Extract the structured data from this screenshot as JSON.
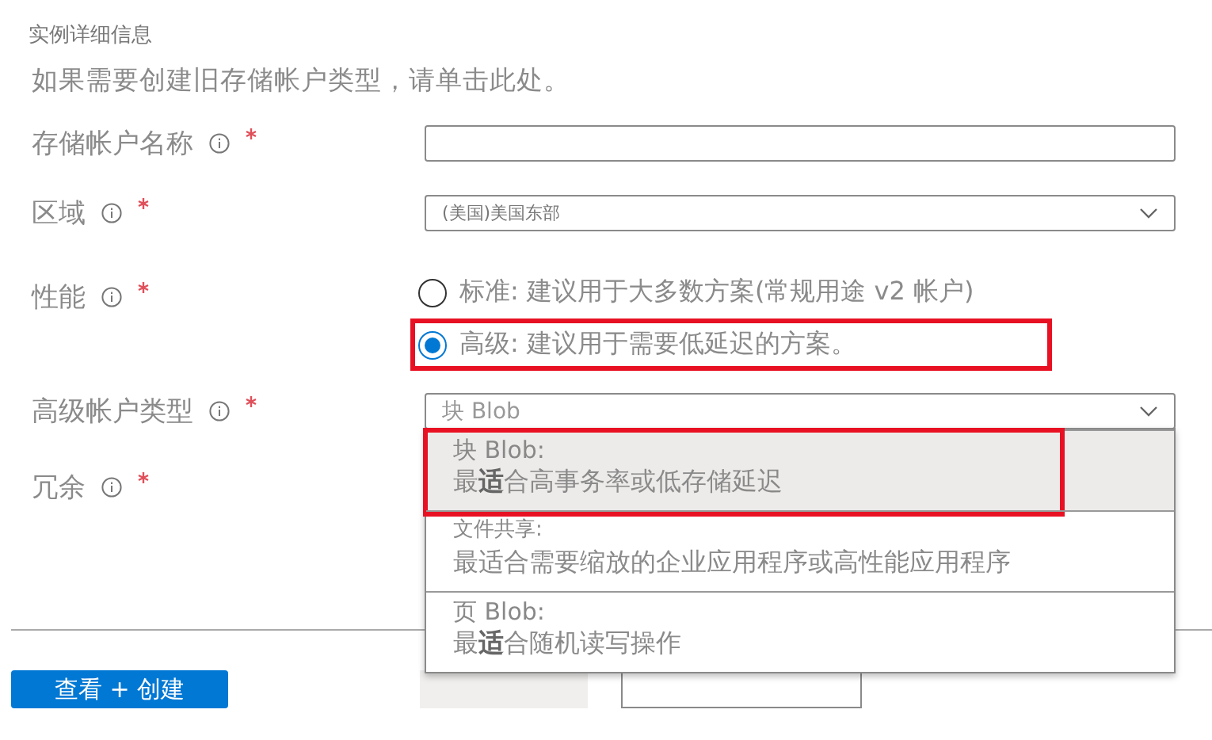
{
  "section_title": "实例详细信息",
  "legacy_link": "如果需要创建旧存储帐户类型，请单击此处。",
  "fields": [
    {
      "kind": "text",
      "label": "存储帐户名称",
      "required": true
    },
    {
      "kind": "select",
      "label": "区域",
      "required": true,
      "value": "(美国)美国东部"
    },
    {
      "kind": "radio",
      "label": "性能",
      "required": true,
      "options": [
        {
          "text": "标准: 建议用于大多数方案(常规用途 v2 帐户)",
          "selected": false,
          "highlighted": false
        },
        {
          "text": "高级: 建议用于需要低延迟的方案。",
          "selected": true,
          "highlighted": true
        }
      ]
    },
    {
      "kind": "select",
      "label": "高级帐户类型",
      "required": true,
      "value": "块 Blob",
      "open": true,
      "options": [
        {
          "title": "块 Blob:",
          "description": "最**适**合高事务率或低存储延迟",
          "selected": true,
          "highlighted": true
        },
        {
          "title": "文件共享:",
          "description": "最适合需要缩放的企业应用程序或高性能应用程序",
          "selected": false,
          "highlighted": false
        },
        {
          "title": "页 Blob:",
          "description": "最**适**合随机读写操作",
          "selected": false,
          "highlighted": false
        }
      ]
    },
    {
      "kind": "select-hidden",
      "label": "冗余",
      "required": true
    }
  ],
  "buttons": [
    {
      "kind": "primary",
      "label": "查看 + 创建"
    },
    {
      "kind": "secondary"
    },
    {
      "kind": "outline"
    }
  ]
}
